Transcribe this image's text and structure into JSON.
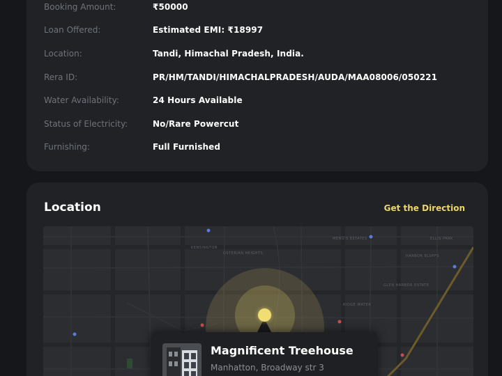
{
  "details": [
    {
      "label": "Booking Amount:",
      "value": "₹50000"
    },
    {
      "label": "Loan Offered:",
      "value": "Estimated EMI: ₹18997"
    },
    {
      "label": "Location:",
      "value": "Tandi, Himachal Pradesh, India."
    },
    {
      "label": "Rera ID:",
      "value": "PR/HM/TANDI/HIMACHALPRADESH/AUDA/MAA08006/050221"
    },
    {
      "label": "Water Availability:",
      "value": "24 Hours Available"
    },
    {
      "label": "Status of Electricity:",
      "value": "No/Rare Powercut"
    },
    {
      "label": "Furnishing:",
      "value": "Full Furnished"
    }
  ],
  "location_section": {
    "title": "Location",
    "direction_link": "Get the Direction"
  },
  "map": {
    "labels": [
      "KENSINGTON",
      "OSTERIAN HEIGHTS",
      "MENG'S ESTATES",
      "RIDGE WATER",
      "GLEN HARBOR ESTATE",
      "HARBOR BLUFFS",
      "ELLIS PARK"
    ],
    "accent_color": "#ecd66a"
  },
  "property": {
    "name": "Magnificent Treehouse",
    "address": "Manhatton, Broadway str 3"
  },
  "colors": {
    "background": "#16171a",
    "card": "#202225",
    "label": "#6f737a",
    "accent": "#ecd66a"
  }
}
